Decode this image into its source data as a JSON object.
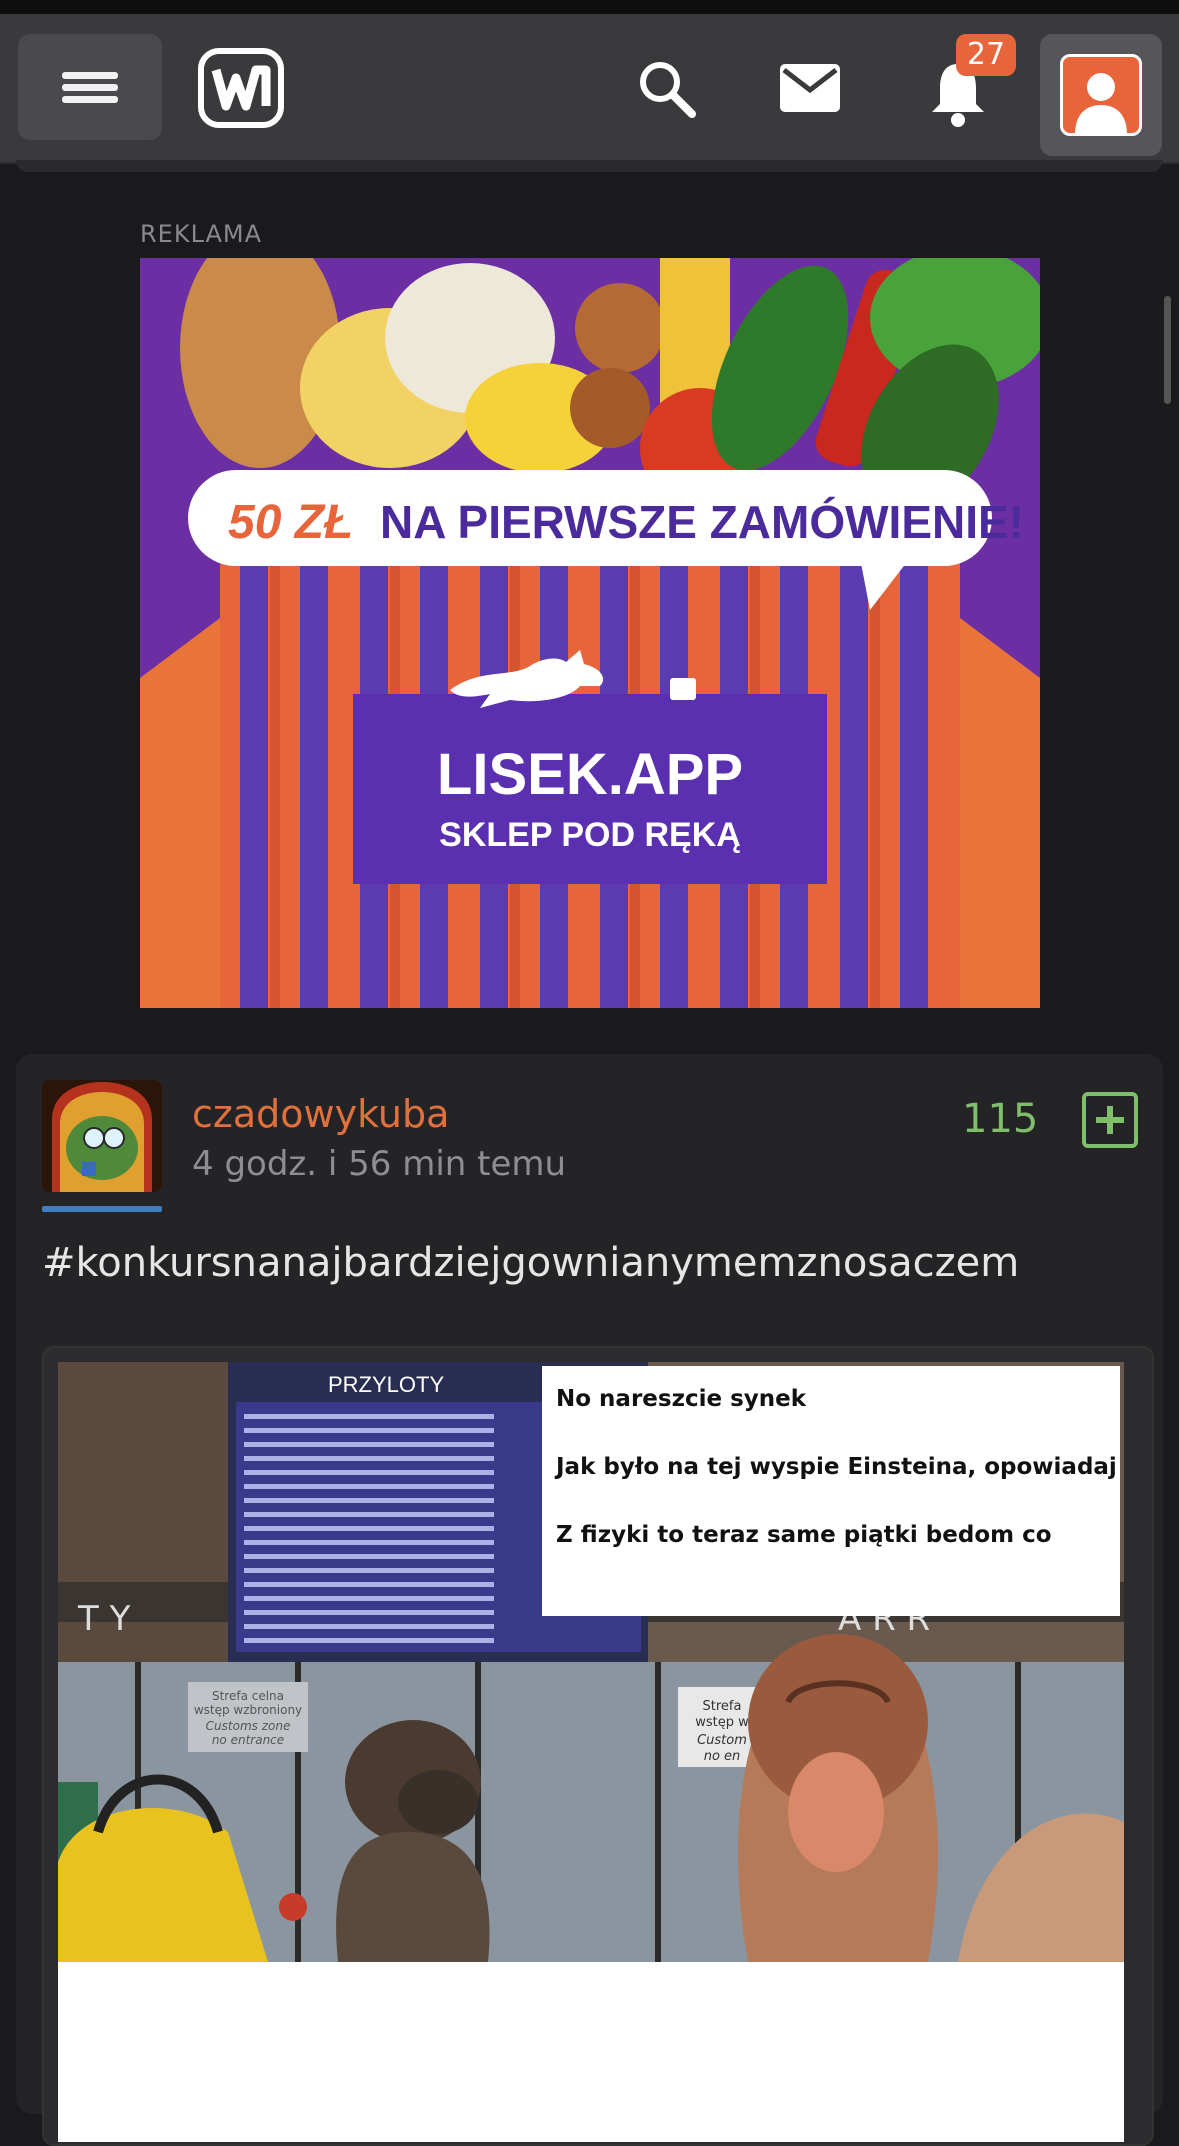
{
  "header": {
    "notification_count": "27",
    "icons": [
      "menu-icon",
      "site-logo",
      "search-icon",
      "mail-icon",
      "bell-icon",
      "user-avatar-icon"
    ]
  },
  "ad": {
    "label": "REKLAMA",
    "amount": "50 ZŁ",
    "headline": "NA PIERWSZE ZAMÓWIENIE!",
    "brand": "LISEK.APP",
    "tagline": "SKLEP POD RĘKĄ"
  },
  "post": {
    "username": "czadowykuba",
    "time": "4 godz. i 56 min temu",
    "votes": "115",
    "hashtag": "#konkursnanajbardziejgownianymemznosaczem",
    "meme": {
      "board_title": "PRZYLOTY",
      "lines": [
        "No nareszcie synek",
        "Jak było na tej wyspie Einsteina, opowiadaj",
        "Z fizyki to teraz same piątki bedom co"
      ],
      "sign_left": [
        "Strefa celna",
        "wstęp wzbroniony",
        "Customs zone",
        "no entrance"
      ],
      "sign_right": [
        "Strefa",
        "wstęp w",
        "Custom",
        "no en"
      ]
    }
  },
  "colors": {
    "accent": "#e8643a",
    "vote_green": "#7fbe6a",
    "background": "#1a1a1c",
    "header": "#3a3a3d",
    "card": "#242426"
  }
}
